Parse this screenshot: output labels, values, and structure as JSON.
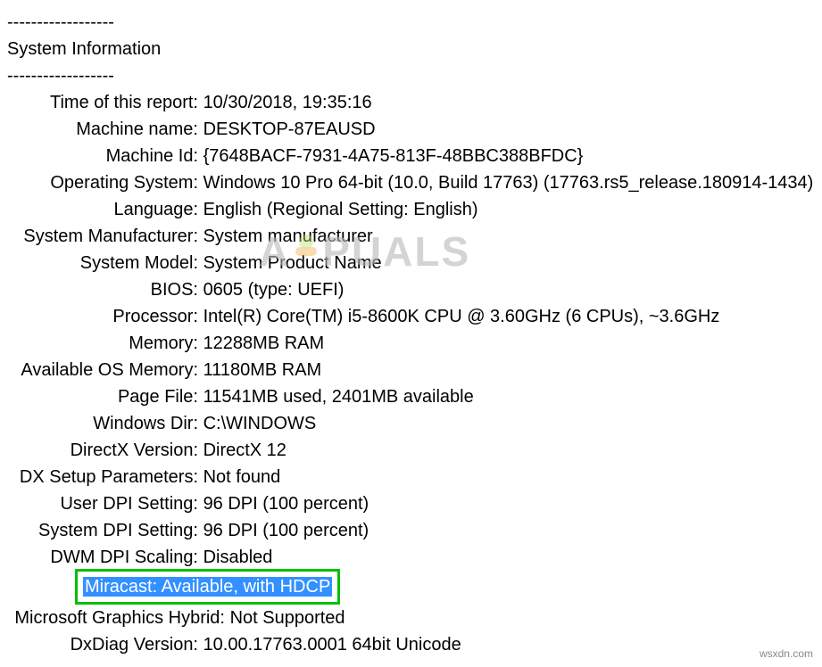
{
  "separator": "------------------",
  "section_title": "System Information",
  "rows": [
    {
      "label": "Time of this report:",
      "value": "10/30/2018, 19:35:16"
    },
    {
      "label": "Machine name:",
      "value": "DESKTOP-87EAUSD"
    },
    {
      "label": "Machine Id:",
      "value": "{7648BACF-7931-4A75-813F-48BBC388BFDC}"
    },
    {
      "label": "Operating System:",
      "value": "Windows 10 Pro 64-bit (10.0, Build 17763) (17763.rs5_release.180914-1434)"
    },
    {
      "label": "Language:",
      "value": "English (Regional Setting: English)"
    },
    {
      "label": "System Manufacturer:",
      "value": "System manufacturer"
    },
    {
      "label": "System Model:",
      "value": "System Product Name"
    },
    {
      "label": "BIOS:",
      "value": "0605 (type: UEFI)"
    },
    {
      "label": "Processor:",
      "value": "Intel(R) Core(TM) i5-8600K CPU @ 3.60GHz (6 CPUs), ~3.6GHz"
    },
    {
      "label": "Memory:",
      "value": "12288MB RAM"
    },
    {
      "label": "Available OS Memory:",
      "value": "11180MB RAM"
    },
    {
      "label": "Page File:",
      "value": "11541MB used, 2401MB available"
    },
    {
      "label": "Windows Dir:",
      "value": "C:\\WINDOWS"
    },
    {
      "label": "DirectX Version:",
      "value": "DirectX 12"
    },
    {
      "label": "DX Setup Parameters:",
      "value": "Not found"
    },
    {
      "label": "User DPI Setting:",
      "value": "96 DPI (100 percent)"
    },
    {
      "label": "System DPI Setting:",
      "value": "96 DPI (100 percent)"
    },
    {
      "label": "DWM DPI Scaling:",
      "value": "Disabled"
    }
  ],
  "highlight": {
    "label": "Miracast:",
    "value": "Available, with HDCP"
  },
  "rows_after": [
    {
      "label": "Microsoft Graphics Hybrid:",
      "value": "Not Supported"
    },
    {
      "label": "DxDiag Version:",
      "value": "10.00.17763.0001 64bit Unicode"
    }
  ],
  "watermark_text": "A  PUALS",
  "source": "wsxdn.com"
}
